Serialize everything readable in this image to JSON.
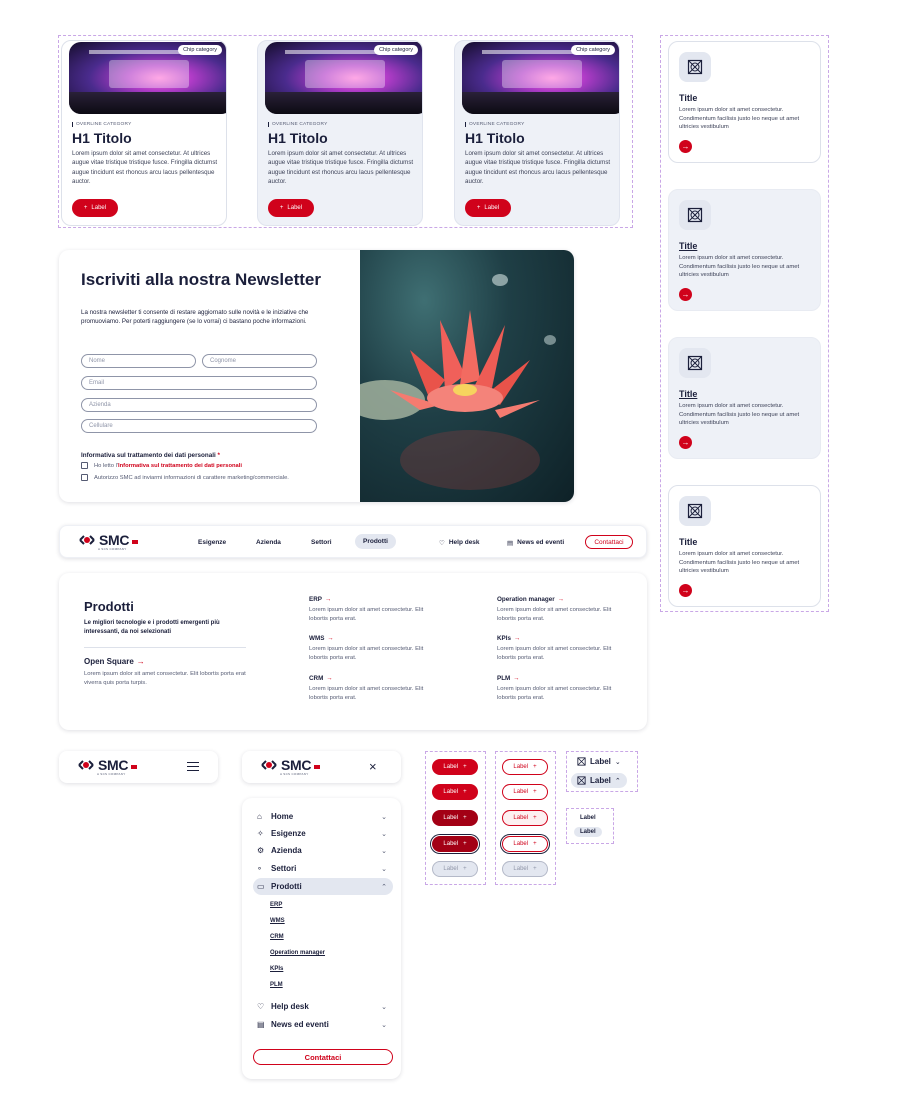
{
  "product_cards": [
    {
      "chip": "Chip category",
      "overline": "OVERLINE CATEGORY",
      "title": "H1 Titolo",
      "desc": "Lorem ipsum dolor sit amet consectetur. At ultrices augue vitae tristique tristique fusce. Fringilla dictumst augue tincidunt est rhoncus arcu lacus pellentesque auctor.",
      "button": "Label"
    },
    {
      "chip": "Chip category",
      "overline": "OVERLINE CATEGORY",
      "title": "H1 Titolo",
      "desc": "Lorem ipsum dolor sit amet consectetur. At ultrices augue vitae tristique tristique fusce. Fringilla dictumst augue tincidunt est rhoncus arcu lacus pellentesque auctor.",
      "button": "Label"
    },
    {
      "chip": "Chip category",
      "overline": "OVERLINE CATEGORY",
      "title": "H1 Titolo",
      "desc": "Lorem ipsum dolor sit amet consectetur. At ultrices augue vitae tristique tristique fusce. Fringilla dictumst augue tincidunt est rhoncus arcu lacus pellentesque auctor.",
      "button": "Label"
    }
  ],
  "icon_cards": [
    {
      "title": "Title",
      "desc": "Lorem ipsum dolor sit amet consectetur. Condimentum facilisis justo leo neque ut amet ultricies vestibulum"
    },
    {
      "title": "Title",
      "desc": "Lorem ipsum dolor sit amet consectetur. Condimentum facilisis justo leo neque ut amet ultricies vestibulum"
    },
    {
      "title": "Title",
      "desc": "Lorem ipsum dolor sit amet consectetur. Condimentum facilisis justo leo neque ut amet ultricies vestibulum"
    },
    {
      "title": "Title",
      "desc": "Lorem ipsum dolor sit amet consectetur. Condimentum facilisis justo leo neque ut amet ultricies vestibulum"
    }
  ],
  "newsletter": {
    "title": "Iscriviti alla nostra Newsletter",
    "desc": "La nostra newsletter ti consente di restare aggiornato sulle novità e le iniziative che promuoviamo. Per poterti raggiungere (se lo vorrai) ci bastano poche informazioni.",
    "placeholders": {
      "nome": "Nome",
      "cognome": "Cognome",
      "email": "Email",
      "azienda": "Azienda",
      "cellulare": "Cellulare"
    },
    "privacy_title": "Informativa sul trattamento dei dati personali",
    "required_mark": "*",
    "check1_prefix": "Ho letto l'",
    "check1_link": "Informativa sul trattamento dei dati personali",
    "check2": "Autorizzo SMC ad inviarmi informazioni di carattere marketing/commerciale."
  },
  "brand": {
    "name": "SMC",
    "tagline": "A SCS COMPANY",
    "accent": "#d0021b",
    "navy": "#1b1f3b"
  },
  "nav": {
    "items": [
      "Esigenze",
      "Azienda",
      "Settori",
      "Prodotti"
    ],
    "active": "Prodotti",
    "help": "Help desk",
    "news": "News ed eventi",
    "cta": "Contattaci"
  },
  "mega": {
    "title": "Prodotti",
    "subtitle": "Le migliori tecnologie e i prodotti emergenti più interessanti, da noi selezionati",
    "open_title": "Open Square",
    "open_desc": "Lorem ipsum dolor sit amet consectetur. Elit lobortis porta erat viverra quis porta turpis.",
    "items": [
      {
        "title": "ERP",
        "desc": "Lorem ipsum dolor sit amet consectetur. Elit lobortis porta erat."
      },
      {
        "title": "WMS",
        "desc": "Lorem ipsum dolor sit amet consectetur. Elit lobortis porta erat."
      },
      {
        "title": "CRM",
        "desc": "Lorem ipsum dolor sit amet consectetur. Elit lobortis porta erat."
      },
      {
        "title": "Operation manager",
        "desc": "Lorem ipsum dolor sit amet consectetur. Elit lobortis porta erat."
      },
      {
        "title": "KPIs",
        "desc": "Lorem ipsum dolor sit amet consectetur. Elit lobortis porta erat."
      },
      {
        "title": "PLM",
        "desc": "Lorem ipsum dolor sit amet consectetur. Elit lobortis porta erat."
      }
    ]
  },
  "mobile_menu": {
    "items": [
      {
        "label": "Home",
        "icon": "home-icon"
      },
      {
        "label": "Esigenze",
        "icon": "needs-icon"
      },
      {
        "label": "Azienda",
        "icon": "company-icon"
      },
      {
        "label": "Settori",
        "icon": "sectors-icon"
      },
      {
        "label": "Prodotti",
        "icon": "products-icon"
      }
    ],
    "subitems": [
      "ERP",
      "WMS",
      "CRM",
      "Operation manager",
      "KPIs",
      "PLM"
    ],
    "bottom_items": [
      {
        "label": "Help desk",
        "icon": "helpdesk-icon"
      },
      {
        "label": "News ed eventi",
        "icon": "news-icon"
      }
    ],
    "cta": "Contattaci"
  },
  "button_variants": {
    "label": "Label"
  }
}
